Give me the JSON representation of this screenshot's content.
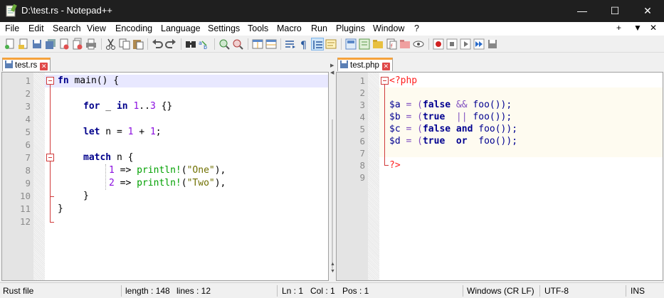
{
  "window": {
    "title": "D:\\test.rs - Notepad++",
    "minimize": "—",
    "maximize": "☐",
    "close": "✕"
  },
  "menu": {
    "items": [
      "File",
      "Edit",
      "Search",
      "View",
      "Encoding",
      "Language",
      "Settings",
      "Tools",
      "Macro",
      "Run",
      "Plugins",
      "Window",
      "?"
    ],
    "right": [
      "+",
      "▼",
      "✕"
    ]
  },
  "toolbar": {
    "icons": [
      "new-file-icon",
      "open-file-icon",
      "save-icon",
      "save-all-icon",
      "close-icon",
      "close-all-icon",
      "print-icon",
      "cut-icon",
      "copy-icon",
      "paste-icon",
      "undo-icon",
      "redo-icon",
      "find-icon",
      "replace-icon",
      "zoom-in-icon",
      "zoom-out-icon",
      "sync-vertical-icon",
      "sync-horizontal-icon",
      "word-wrap-icon",
      "show-all-chars-icon",
      "indent-guide-icon",
      "user-defined-language-icon",
      "document-map-icon",
      "function-list-icon",
      "folder-as-workspace-icon",
      "document-list-icon",
      "monitoring-icon",
      "record-macro-icon",
      "stop-record-icon",
      "play-macro-icon",
      "run-macro-multiple-icon",
      "save-macro-icon"
    ]
  },
  "left_pane": {
    "tab_label": "test.rs",
    "line_numbers": [
      "1",
      "2",
      "3",
      "4",
      "5",
      "6",
      "7",
      "8",
      "9",
      "10",
      "11",
      "12"
    ]
  },
  "right_pane": {
    "tab_label": "test.php",
    "line_numbers": [
      "1",
      "2",
      "3",
      "4",
      "5",
      "6",
      "7",
      "8",
      "9"
    ]
  },
  "code_rs": {
    "l1_kw": "fn",
    "l1_rest": " main() {",
    "l3_for": "for",
    "l3_mid": " _ ",
    "l3_in": "in",
    "l3_n1": "1",
    "l3_dots": "..",
    "l3_n2": "3",
    "l3_end": " {}",
    "l5_let": "let",
    "l5_mid": " n = ",
    "l5_n1": "1",
    "l5_plus": " + ",
    "l5_n2": "1",
    "l5_end": ";",
    "l7_match": "match",
    "l7_end": " n {",
    "l8_num": "1",
    "l8_arrow": " => ",
    "l8_mac": "println!",
    "l8_open": "(",
    "l8_str": "\"One\"",
    "l8_close": "),",
    "l9_num": "2",
    "l9_arrow": " => ",
    "l9_mac": "println!",
    "l9_open": "(",
    "l9_str": "\"Two\"",
    "l9_close": "),",
    "l10": "}",
    "l11": "}"
  },
  "code_php": {
    "open_tag": "<?php",
    "lines": [
      {
        "var": "$a",
        "eq": " = (",
        "v1": "false",
        "op": " && ",
        "call": "foo());"
      },
      {
        "var": "$b",
        "eq": " = (",
        "v1": "true",
        "op": "  || ",
        "call": "foo());"
      },
      {
        "var": "$c",
        "eq": " = (",
        "v1": "false",
        "op": " and ",
        "call": "foo());"
      },
      {
        "var": "$d",
        "eq": " = (",
        "v1": "true",
        "op": "  or  ",
        "call": "foo());"
      }
    ],
    "close_tag": "?>"
  },
  "status": {
    "file_type": "Rust file",
    "length": "length : 148",
    "lines": "lines : 12",
    "ln": "Ln : 1",
    "col": "Col : 1",
    "pos": "Pos : 1",
    "eol": "Windows (CR LF)",
    "encoding": "UTF-8",
    "mode": "INS"
  },
  "colors": {
    "titlebar": "#1f1f1f",
    "current_line": "#e8e8ff",
    "keyword": "#00008b",
    "number": "#8b0fe0",
    "macro": "#00a000",
    "string": "#707000",
    "php_tag": "#ff2020",
    "fold": "#d03a3a",
    "tab_accent": "#f5a23c"
  }
}
